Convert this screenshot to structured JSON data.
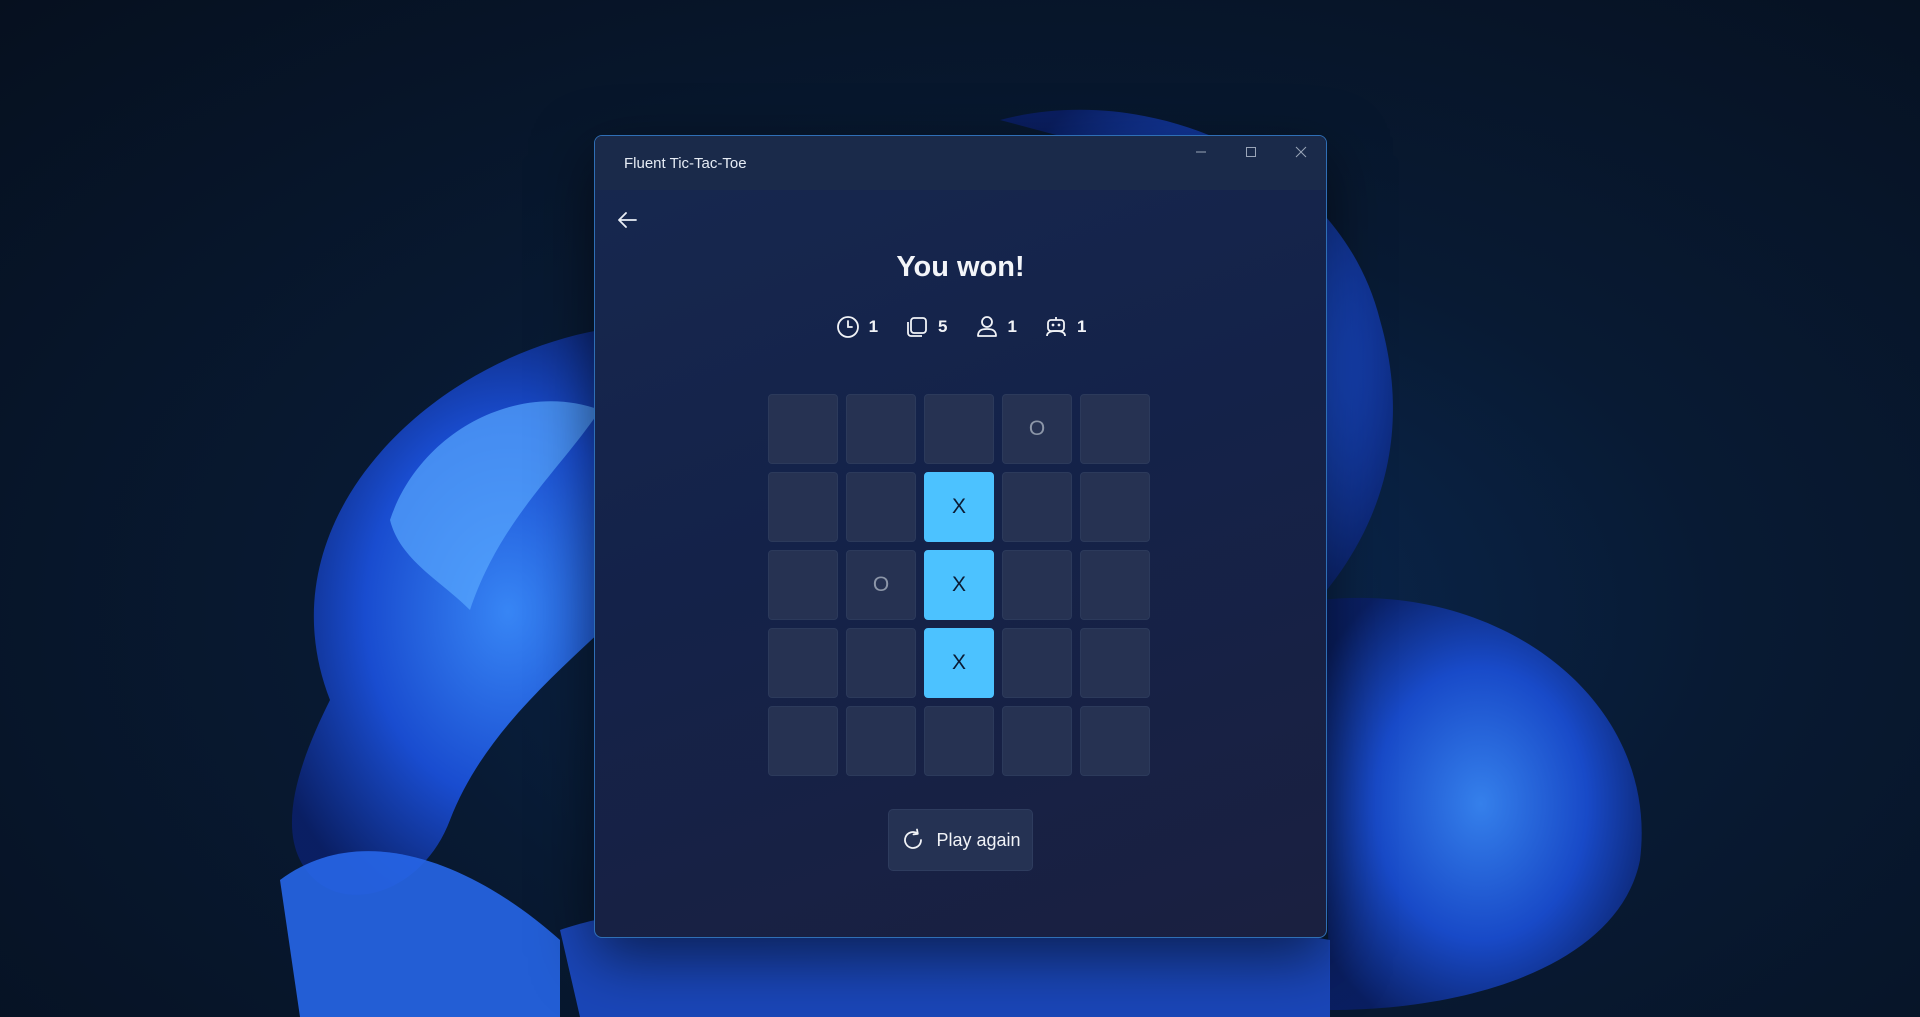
{
  "window": {
    "title": "Fluent Tic-Tac-Toe"
  },
  "game": {
    "result_text": "You won!",
    "stats": [
      {
        "icon": "clock-icon",
        "value": "1"
      },
      {
        "icon": "moves-icon",
        "value": "5"
      },
      {
        "icon": "person-icon",
        "value": "1"
      },
      {
        "icon": "robot-icon",
        "value": "1"
      }
    ],
    "board": [
      [
        "",
        "",
        "",
        "O",
        ""
      ],
      [
        "",
        "",
        "X",
        "",
        ""
      ],
      [
        "",
        "O",
        "X",
        "",
        ""
      ],
      [
        "",
        "",
        "X",
        "",
        ""
      ],
      [
        "",
        "",
        "",
        "",
        ""
      ]
    ],
    "winning_cells": [
      [
        1,
        2
      ],
      [
        2,
        2
      ],
      [
        3,
        2
      ]
    ],
    "play_again_label": "Play again"
  },
  "colors": {
    "accent": "#4cc2ff",
    "cell": "#263252",
    "window_bg": "#17284f"
  }
}
